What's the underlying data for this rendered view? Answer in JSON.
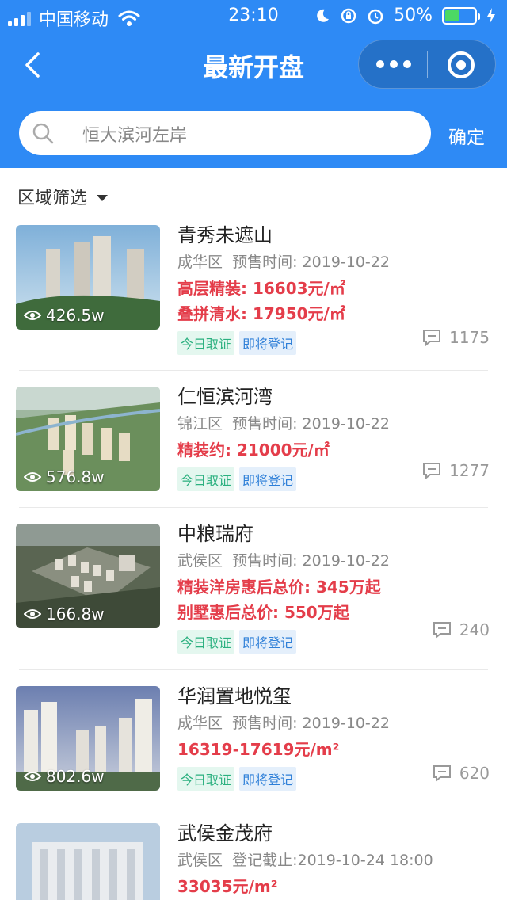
{
  "status_bar": {
    "carrier": "中国移动",
    "time": "23:10",
    "battery": "50%",
    "battery_level": 0.5
  },
  "nav": {
    "title": "最新开盘"
  },
  "search": {
    "placeholder": "恒大滨河左岸",
    "confirm_label": "确定"
  },
  "filter": {
    "label": "区域筛选"
  },
  "listings": [
    {
      "name": "青秀未遮山",
      "district": "成华区",
      "date_label": "预售时间: 2019-10-22",
      "prices": [
        "高层精装: 16603元/㎡",
        "叠拼清水: 17950元/㎡"
      ],
      "views": "426.5w",
      "tags": [
        "今日取证",
        "即将登记"
      ],
      "comments": "1175"
    },
    {
      "name": "仁恒滨河湾",
      "district": "锦江区",
      "date_label": "预售时间: 2019-10-22",
      "prices": [
        "精装约: 21000元/㎡"
      ],
      "views": "576.8w",
      "tags": [
        "今日取证",
        "即将登记"
      ],
      "comments": "1277"
    },
    {
      "name": "中粮瑞府",
      "district": "武侯区",
      "date_label": "预售时间: 2019-10-22",
      "prices": [
        "精装洋房惠后总价: 345万起",
        "别墅惠后总价: 550万起"
      ],
      "views": "166.8w",
      "tags": [
        "今日取证",
        "即将登记"
      ],
      "comments": "240"
    },
    {
      "name": "华润置地悦玺",
      "district": "成华区",
      "date_label": "预售时间: 2019-10-22",
      "prices": [
        "16319-17619元/m²"
      ],
      "views": "802.6w",
      "tags": [
        "今日取证",
        "即将登记"
      ],
      "comments": "620"
    },
    {
      "name": "武侯金茂府",
      "district": "武侯区",
      "date_label": "登记截止:2019-10-24 18:00",
      "prices": [
        "33035元/m²"
      ]
    }
  ],
  "colors": {
    "header": "#2e8af5",
    "price": "#e43d4a",
    "tag_green": "#2bb07f",
    "tag_blue": "#2e7fd8"
  },
  "icons": [
    "signal-icon",
    "wifi-icon",
    "moon-icon",
    "rotation-lock-icon",
    "alarm-icon",
    "battery-icon",
    "charging-icon",
    "back-icon",
    "more-icon",
    "target-icon",
    "search-icon",
    "caret-down-icon",
    "eye-icon",
    "comment-icon"
  ]
}
